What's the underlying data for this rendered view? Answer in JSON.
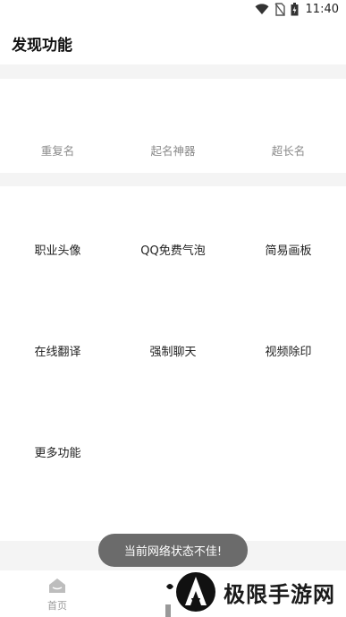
{
  "status_bar": {
    "time": "11:40",
    "icons": [
      "wifi-icon",
      "no-sim-icon",
      "battery-icon"
    ]
  },
  "header": {
    "title": "发现功能"
  },
  "section1": {
    "items": [
      {
        "label": "重复名",
        "icon": ""
      },
      {
        "label": "起名神器",
        "icon": ""
      },
      {
        "label": "超长名",
        "icon": ""
      }
    ]
  },
  "section2": {
    "rows": [
      [
        {
          "label": "职业头像"
        },
        {
          "label": "QQ免费气泡"
        },
        {
          "label": "简易画板"
        }
      ],
      [
        {
          "label": "在线翻译"
        },
        {
          "label": "强制聊天"
        },
        {
          "label": "视频除印"
        }
      ],
      [
        {
          "label": "更多功能"
        }
      ]
    ]
  },
  "toast": {
    "text": "当前网络状态不佳!"
  },
  "bottom_nav": {
    "home_label": "首页",
    "icons": [
      "home-icon"
    ]
  },
  "watermark": {
    "text": "极限手游网"
  },
  "colors": {
    "muted_text": "#8a8a8a",
    "section_gap": "#f4f4f4",
    "toast_bg": "#6b6b6b"
  }
}
